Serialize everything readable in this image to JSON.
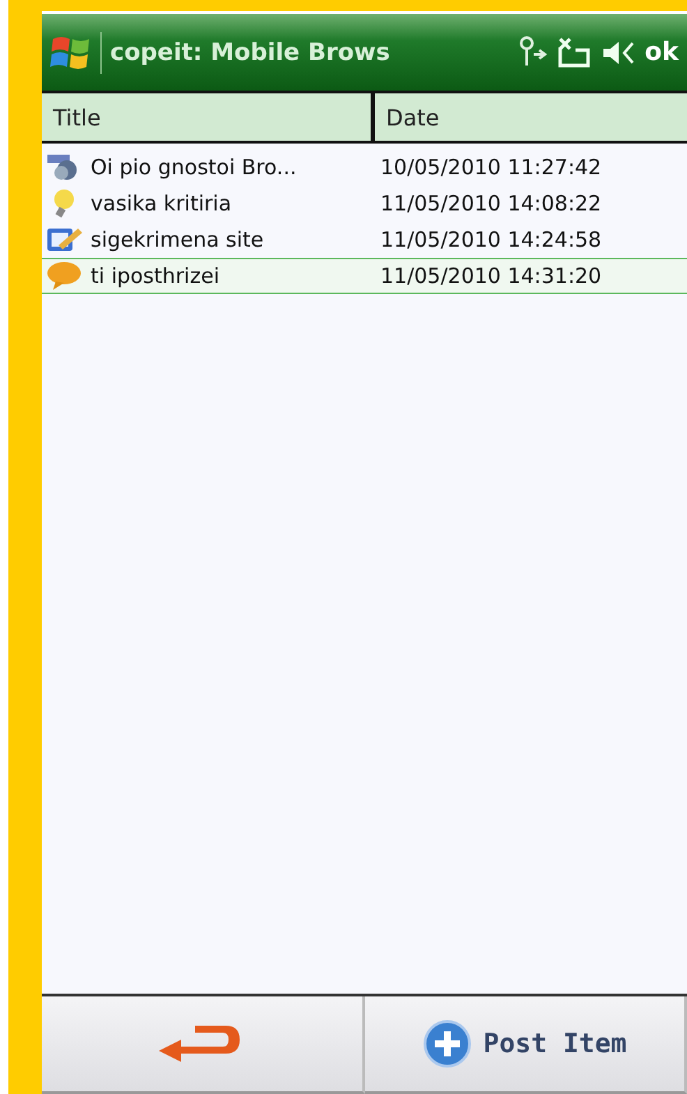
{
  "title_bar": {
    "title": "copeit: Mobile Brows",
    "ok": "ok"
  },
  "table": {
    "columns": [
      "Title",
      "Date"
    ],
    "rows": [
      {
        "title": "Oi pio gnostoi Bro...",
        "date": "10/05/2010 11:27:42",
        "kind": "web",
        "selected": false
      },
      {
        "title": "vasika kritiria",
        "date": "11/05/2010 14:08:22",
        "kind": "bulb",
        "selected": false
      },
      {
        "title": "sigekrimena site",
        "date": "11/05/2010 14:24:58",
        "kind": "note",
        "selected": false
      },
      {
        "title": "ti iposthrizei",
        "date": "11/05/2010 14:31:20",
        "kind": "chat",
        "selected": true
      }
    ]
  },
  "softkeys": {
    "right": "Post Item"
  }
}
